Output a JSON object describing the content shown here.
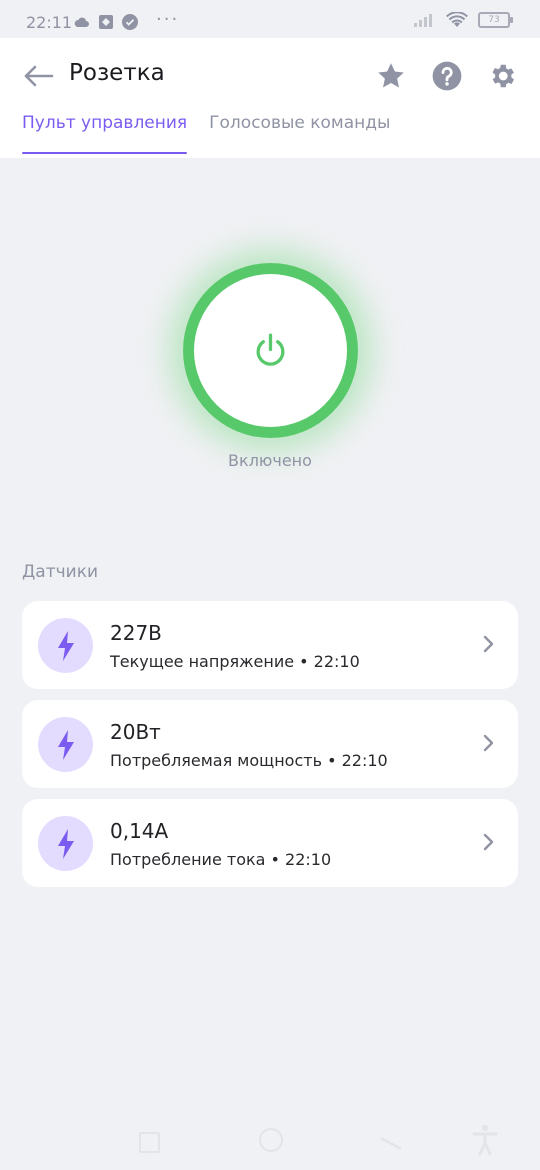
{
  "status_bar": {
    "time": "22:11",
    "dots": "···",
    "battery": "73"
  },
  "header": {
    "title": "Розетка",
    "tabs": [
      {
        "label": "Пульт управления",
        "active": true
      },
      {
        "label": "Голосовые команды",
        "active": false
      }
    ],
    "icons": [
      "back-arrow-icon",
      "star-icon",
      "help-icon",
      "gear-icon"
    ]
  },
  "power": {
    "state_label": "Включено",
    "on": true,
    "color": "#58c96a"
  },
  "sensors": {
    "title": "Датчики",
    "items": [
      {
        "value": "227В",
        "label": "Текущее напряжение",
        "time": "22:10",
        "sub": "Текущее напряжение • 22:10"
      },
      {
        "value": "20Вт",
        "label": "Потребляемая мощность",
        "time": "22:10",
        "sub": "Потребляемая мощность • 22:10"
      },
      {
        "value": "0,14А",
        "label": "Потребление тока",
        "time": "22:10",
        "sub": "Потребление тока • 22:10"
      }
    ]
  },
  "colors": {
    "accent": "#7c5cf0",
    "icon_bg": "#e3dcff",
    "background": "#f0f1f4",
    "muted": "#8f93a3"
  }
}
